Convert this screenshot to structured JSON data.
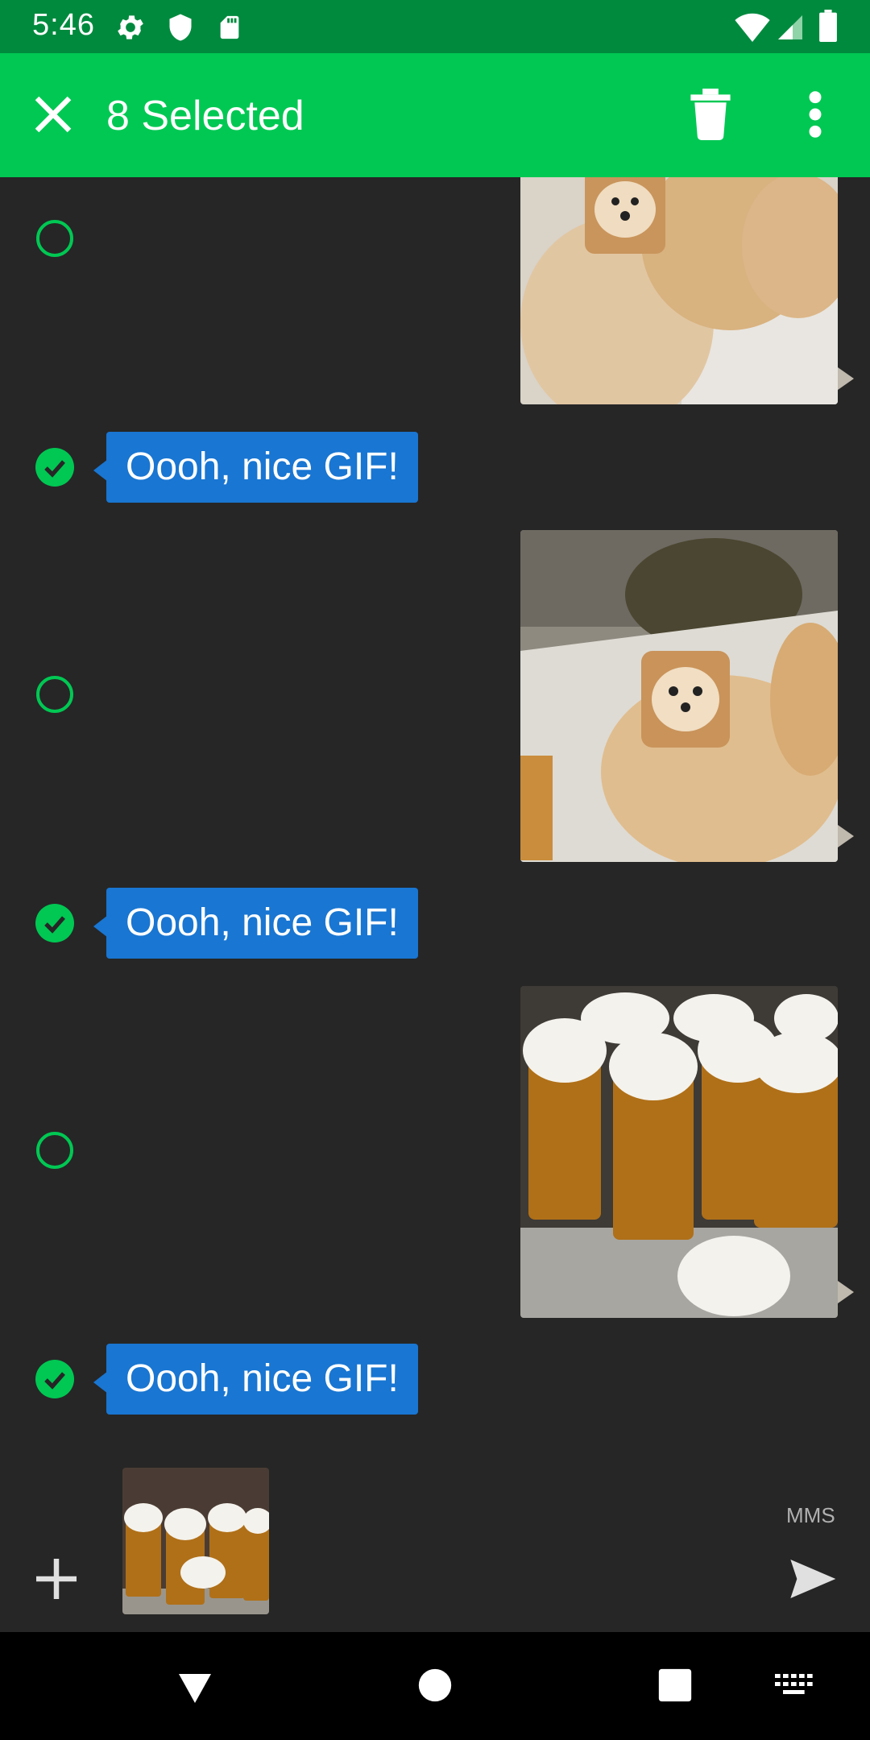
{
  "status_bar": {
    "time": "5:46",
    "icons_left": [
      "settings-gear-icon",
      "shield-icon",
      "sd-card-icon"
    ],
    "icons_right": [
      "wifi-icon",
      "signal-icon",
      "battery-icon"
    ],
    "bg_color": "#008a3e"
  },
  "app_bar": {
    "title": "8 Selected",
    "bg_color": "#00c853",
    "actions": [
      "close-icon",
      "delete-icon",
      "more-vert-icon"
    ]
  },
  "messages": [
    {
      "type": "image",
      "content": "pomeranian dogs gif",
      "selected": false
    },
    {
      "type": "text",
      "text": "Oooh, nice GIF!",
      "selected": true
    },
    {
      "type": "image",
      "content": "pomeranian with bread on head gif",
      "selected": false
    },
    {
      "type": "text",
      "text": "Oooh, nice GIF!",
      "selected": true
    },
    {
      "type": "image",
      "content": "beer steins gif",
      "selected": false
    },
    {
      "type": "text",
      "text": "Oooh, nice GIF!",
      "selected": true
    }
  ],
  "composer": {
    "attachment": "beer steins thumbnail",
    "mms_label": "MMS",
    "send_icon": "send-icon",
    "add_icon": "add-icon"
  },
  "nav_bar": {
    "items": [
      "back-triangle-icon",
      "home-circle-icon",
      "recents-square-icon",
      "keyboard-icon"
    ]
  },
  "colors": {
    "accent_green": "#00c853",
    "bubble_blue": "#1976d2",
    "background": "#262626"
  }
}
